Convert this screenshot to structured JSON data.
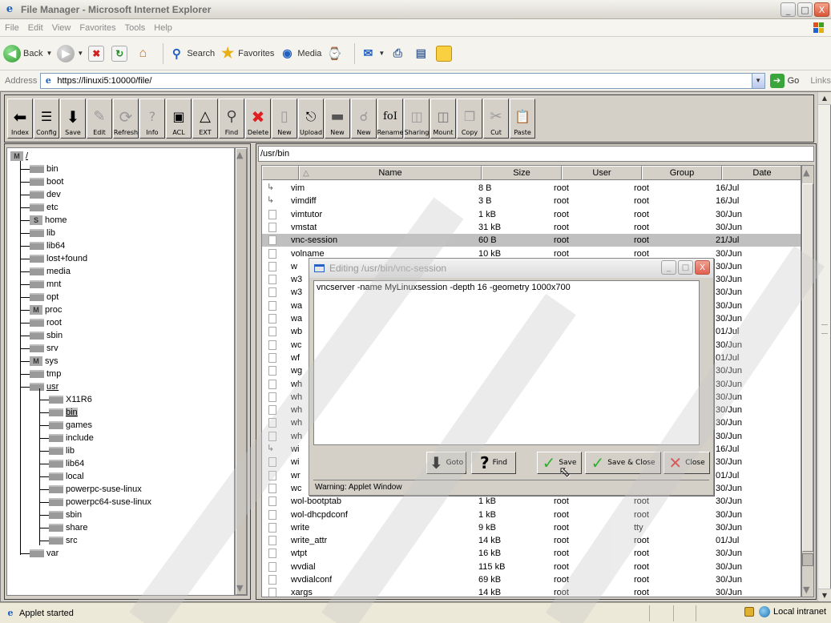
{
  "window": {
    "title": "File Manager - Microsoft Internet Explorer",
    "btn_min": "_",
    "btn_max": "□",
    "btn_close": "X"
  },
  "menu": [
    "File",
    "Edit",
    "View",
    "Favorites",
    "Tools",
    "Help"
  ],
  "stdbar": {
    "back": "Back",
    "search": "Search",
    "favorites": "Favorites",
    "media": "Media"
  },
  "address": {
    "label": "Address",
    "url": "https://linuxi5:10000/file/",
    "go": "Go",
    "links": "Links"
  },
  "toolbar": [
    "Index",
    "Config",
    "Save",
    "Edit",
    "Refresh",
    "Info",
    "ACL",
    "EXT",
    "Find",
    "Delete",
    "New",
    "Upload",
    "New",
    "New",
    "Rename",
    "Sharing",
    "Mount",
    "Copy",
    "Cut",
    "Paste"
  ],
  "tree": {
    "root": "/",
    "root_badge": "M",
    "items": [
      {
        "label": "bin",
        "level": 1
      },
      {
        "label": "boot",
        "level": 1
      },
      {
        "label": "dev",
        "level": 1
      },
      {
        "label": "etc",
        "level": 1
      },
      {
        "label": "home",
        "level": 1,
        "badge": "S"
      },
      {
        "label": "lib",
        "level": 1
      },
      {
        "label": "lib64",
        "level": 1
      },
      {
        "label": "lost+found",
        "level": 1
      },
      {
        "label": "media",
        "level": 1
      },
      {
        "label": "mnt",
        "level": 1
      },
      {
        "label": "opt",
        "level": 1
      },
      {
        "label": "proc",
        "level": 1,
        "badge": "M"
      },
      {
        "label": "root",
        "level": 1
      },
      {
        "label": "sbin",
        "level": 1
      },
      {
        "label": "srv",
        "level": 1
      },
      {
        "label": "sys",
        "level": 1,
        "badge": "M"
      },
      {
        "label": "tmp",
        "level": 1
      },
      {
        "label": "usr",
        "level": 1,
        "underline": true
      },
      {
        "label": "X11R6",
        "level": 2
      },
      {
        "label": "bin",
        "level": 2,
        "selected": true
      },
      {
        "label": "games",
        "level": 2
      },
      {
        "label": "include",
        "level": 2
      },
      {
        "label": "lib",
        "level": 2
      },
      {
        "label": "lib64",
        "level": 2
      },
      {
        "label": "local",
        "level": 2
      },
      {
        "label": "powerpc-suse-linux",
        "level": 2
      },
      {
        "label": "powerpc64-suse-linux",
        "level": 2
      },
      {
        "label": "sbin",
        "level": 2
      },
      {
        "label": "share",
        "level": 2
      },
      {
        "label": "src",
        "level": 2
      },
      {
        "label": "var",
        "level": 1
      }
    ]
  },
  "list": {
    "path": "/usr/bin",
    "columns": [
      "Name",
      "Size",
      "User",
      "Group",
      "Date"
    ],
    "rows": [
      {
        "icon": "link",
        "name": "vim",
        "size": "8 B",
        "user": "root",
        "group": "root",
        "date": "16/Jul"
      },
      {
        "icon": "link",
        "name": "vimdiff",
        "size": "3 B",
        "user": "root",
        "group": "root",
        "date": "16/Jul"
      },
      {
        "icon": "file",
        "name": "vimtutor",
        "size": "1 kB",
        "user": "root",
        "group": "root",
        "date": "30/Jun"
      },
      {
        "icon": "file",
        "name": "vmstat",
        "size": "31 kB",
        "user": "root",
        "group": "root",
        "date": "30/Jun"
      },
      {
        "icon": "file",
        "name": "vnc-session",
        "size": "60 B",
        "user": "root",
        "group": "root",
        "date": "21/Jul",
        "selected": true
      },
      {
        "icon": "file",
        "name": "volname",
        "size": "10 kB",
        "user": "root",
        "group": "root",
        "date": "30/Jun"
      },
      {
        "icon": "file",
        "name": "w",
        "size": "",
        "user": "",
        "group": "",
        "date": "30/Jun"
      },
      {
        "icon": "file",
        "name": "w3",
        "size": "",
        "user": "",
        "group": "",
        "date": "30/Jun"
      },
      {
        "icon": "file",
        "name": "w3",
        "size": "",
        "user": "",
        "group": "",
        "date": "30/Jun"
      },
      {
        "icon": "file",
        "name": "wa",
        "size": "",
        "user": "",
        "group": "",
        "date": "30/Jun"
      },
      {
        "icon": "file",
        "name": "wa",
        "size": "",
        "user": "",
        "group": "",
        "date": "30/Jun"
      },
      {
        "icon": "file",
        "name": "wb",
        "size": "",
        "user": "",
        "group": "",
        "date": "01/Jul"
      },
      {
        "icon": "file",
        "name": "wc",
        "size": "",
        "user": "",
        "group": "",
        "date": "30/Jun"
      },
      {
        "icon": "file",
        "name": "wf",
        "size": "",
        "user": "",
        "group": "",
        "date": "01/Jul"
      },
      {
        "icon": "file",
        "name": "wg",
        "size": "",
        "user": "",
        "group": "",
        "date": "30/Jun"
      },
      {
        "icon": "file",
        "name": "wh",
        "size": "",
        "user": "",
        "group": "",
        "date": "30/Jun"
      },
      {
        "icon": "file",
        "name": "wh",
        "size": "",
        "user": "",
        "group": "",
        "date": "30/Jun"
      },
      {
        "icon": "file",
        "name": "wh",
        "size": "",
        "user": "",
        "group": "",
        "date": "30/Jun"
      },
      {
        "icon": "file",
        "name": "wh",
        "size": "",
        "user": "",
        "group": "",
        "date": "30/Jun"
      },
      {
        "icon": "file",
        "name": "wh",
        "size": "",
        "user": "",
        "group": "",
        "date": "30/Jun"
      },
      {
        "icon": "link",
        "name": "wi",
        "size": "",
        "user": "",
        "group": "",
        "date": "16/Jul"
      },
      {
        "icon": "file",
        "name": "wi",
        "size": "",
        "user": "",
        "group": "",
        "date": "30/Jun"
      },
      {
        "icon": "file",
        "name": "wr",
        "size": "",
        "user": "",
        "group": "",
        "date": "01/Jul"
      },
      {
        "icon": "file",
        "name": "wc",
        "size": "",
        "user": "",
        "group": "",
        "date": "30/Jun"
      },
      {
        "icon": "file",
        "name": "wol-bootptab",
        "size": "1 kB",
        "user": "root",
        "group": "root",
        "date": "30/Jun"
      },
      {
        "icon": "file",
        "name": "wol-dhcpdconf",
        "size": "1 kB",
        "user": "root",
        "group": "root",
        "date": "30/Jun"
      },
      {
        "icon": "file",
        "name": "write",
        "size": "9 kB",
        "user": "root",
        "group": "tty",
        "date": "30/Jun"
      },
      {
        "icon": "file",
        "name": "write_attr",
        "size": "14 kB",
        "user": "root",
        "group": "root",
        "date": "01/Jul"
      },
      {
        "icon": "file",
        "name": "wtpt",
        "size": "16 kB",
        "user": "root",
        "group": "root",
        "date": "30/Jun"
      },
      {
        "icon": "file",
        "name": "wvdial",
        "size": "115 kB",
        "user": "root",
        "group": "root",
        "date": "30/Jun"
      },
      {
        "icon": "file",
        "name": "wvdialconf",
        "size": "69 kB",
        "user": "root",
        "group": "root",
        "date": "30/Jun"
      },
      {
        "icon": "file",
        "name": "xargs",
        "size": "14 kB",
        "user": "root",
        "group": "root",
        "date": "30/Jun"
      }
    ]
  },
  "editor": {
    "title": "Editing /usr/bin/vnc-session",
    "content": "vncserver -name MyLinuxsession -depth 16 -geometry 1000x700",
    "buttons": {
      "goto": "Goto",
      "find": "Find",
      "save": "Save",
      "save_close": "Save & Close",
      "close": "Close"
    },
    "warning": "Warning: Applet Window"
  },
  "status": {
    "text": "Applet started",
    "zone": "Local intranet"
  },
  "colors": {
    "selection": "#c0c0c0",
    "panel": "#d4d0c8",
    "check": "#2fb02f",
    "close_x": "#e02020"
  }
}
